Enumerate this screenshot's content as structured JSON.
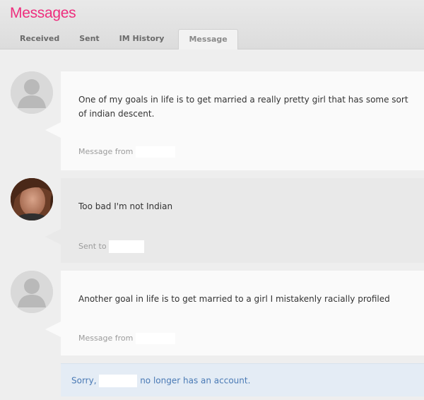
{
  "app": {
    "title": "Messages"
  },
  "tabs": [
    {
      "label": "Received"
    },
    {
      "label": "Sent"
    },
    {
      "label": "IM History"
    },
    {
      "label": "Message",
      "active": true
    }
  ],
  "messages": [
    {
      "direction": "received",
      "text": "One of my goals in life is to get married a really pretty girl that has some sort of indian descent.",
      "meta_label": "Message from",
      "avatar_icon": "default-user-icon"
    },
    {
      "direction": "sent",
      "text": "Too bad I'm not Indian",
      "meta_label": "Sent to",
      "avatar_icon": "user-photo"
    },
    {
      "direction": "received",
      "text": "Another goal in life is to get married to a girl I mistakenly racially profiled",
      "meta_label": "Message from",
      "avatar_icon": "default-user-icon"
    }
  ],
  "notice": {
    "prefix": "Sorry,",
    "suffix": "no longer has an account."
  },
  "colors": {
    "brand": "#ee2d7d",
    "notice_text": "#4a7ab5",
    "notice_bg": "#e4ecf5"
  }
}
